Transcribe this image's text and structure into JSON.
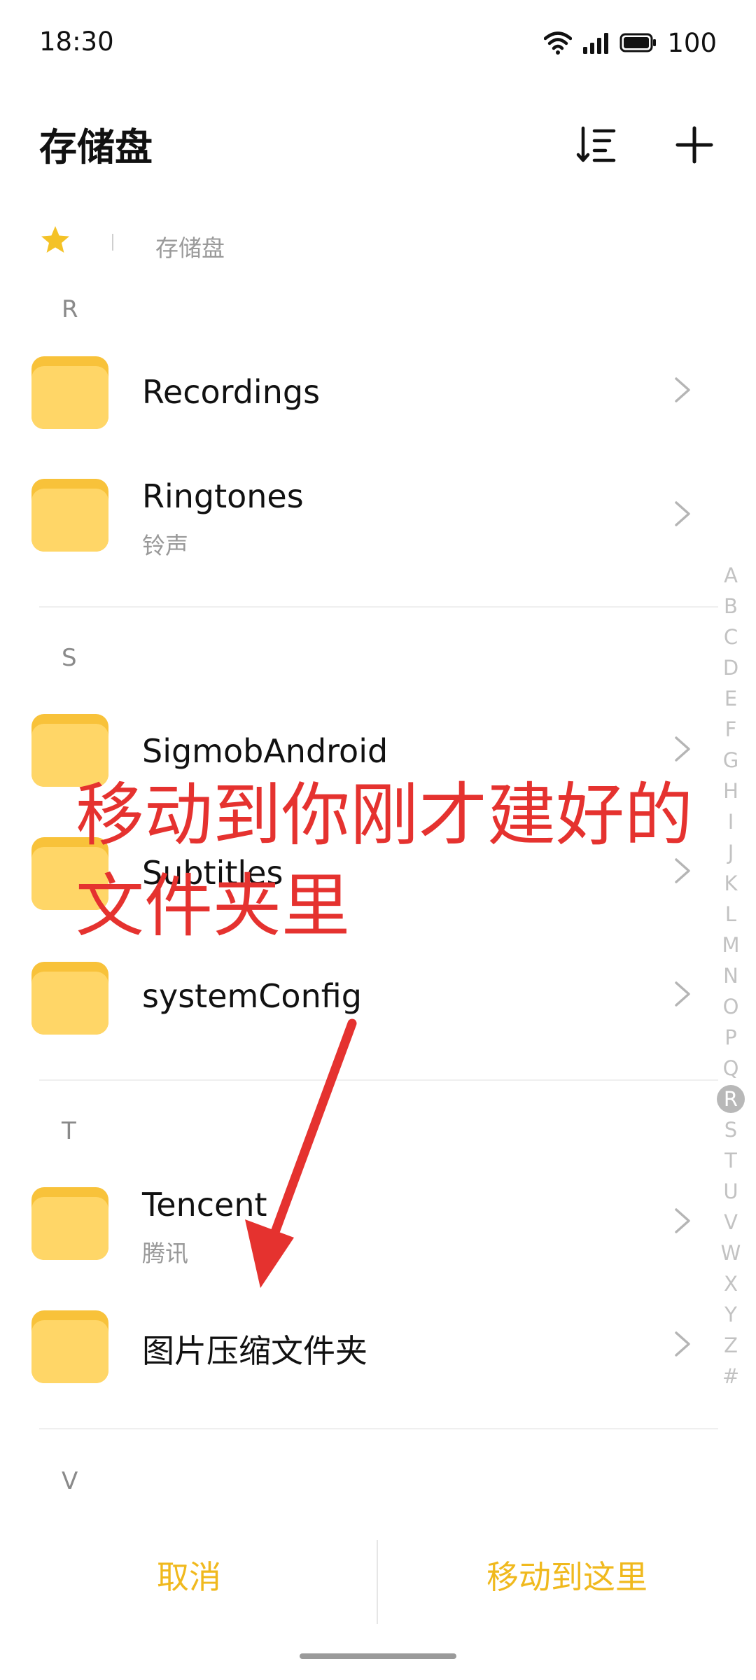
{
  "status": {
    "time": "18:30",
    "battery": "100"
  },
  "header": {
    "title": "存储盘",
    "sort_icon": "sort-icon",
    "add_icon": "plus-icon"
  },
  "breadcrumb": {
    "root_icon": "star-icon",
    "current": "存储盘"
  },
  "sections": [
    {
      "letter": "R",
      "items": [
        {
          "name": "Recordings",
          "subtitle": ""
        },
        {
          "name": "Ringtones",
          "subtitle": "铃声"
        }
      ]
    },
    {
      "letter": "S",
      "items": [
        {
          "name": "SigmobAndroid",
          "subtitle": ""
        },
        {
          "name": "Subtitles",
          "subtitle": ""
        },
        {
          "name": "systemConfig",
          "subtitle": ""
        }
      ]
    },
    {
      "letter": "T",
      "items": [
        {
          "name": "Tencent",
          "subtitle": "腾讯"
        },
        {
          "name": "图片压缩文件夹",
          "subtitle": ""
        }
      ]
    },
    {
      "letter": "V",
      "items": []
    }
  ],
  "alpha_index": [
    "A",
    "B",
    "C",
    "D",
    "E",
    "F",
    "G",
    "H",
    "I",
    "J",
    "K",
    "L",
    "M",
    "N",
    "O",
    "P",
    "Q",
    "R",
    "S",
    "T",
    "U",
    "V",
    "W",
    "X",
    "Y",
    "Z",
    "#"
  ],
  "alpha_active": "R",
  "annotation": {
    "line1": "移动到你刚才建好的",
    "line2": "文件夹里"
  },
  "bottom": {
    "cancel": "取消",
    "move": "移动到这里"
  },
  "colors": {
    "accent": "#f0b91e",
    "folder": "#ffc93c",
    "annotation": "#e5322f"
  }
}
